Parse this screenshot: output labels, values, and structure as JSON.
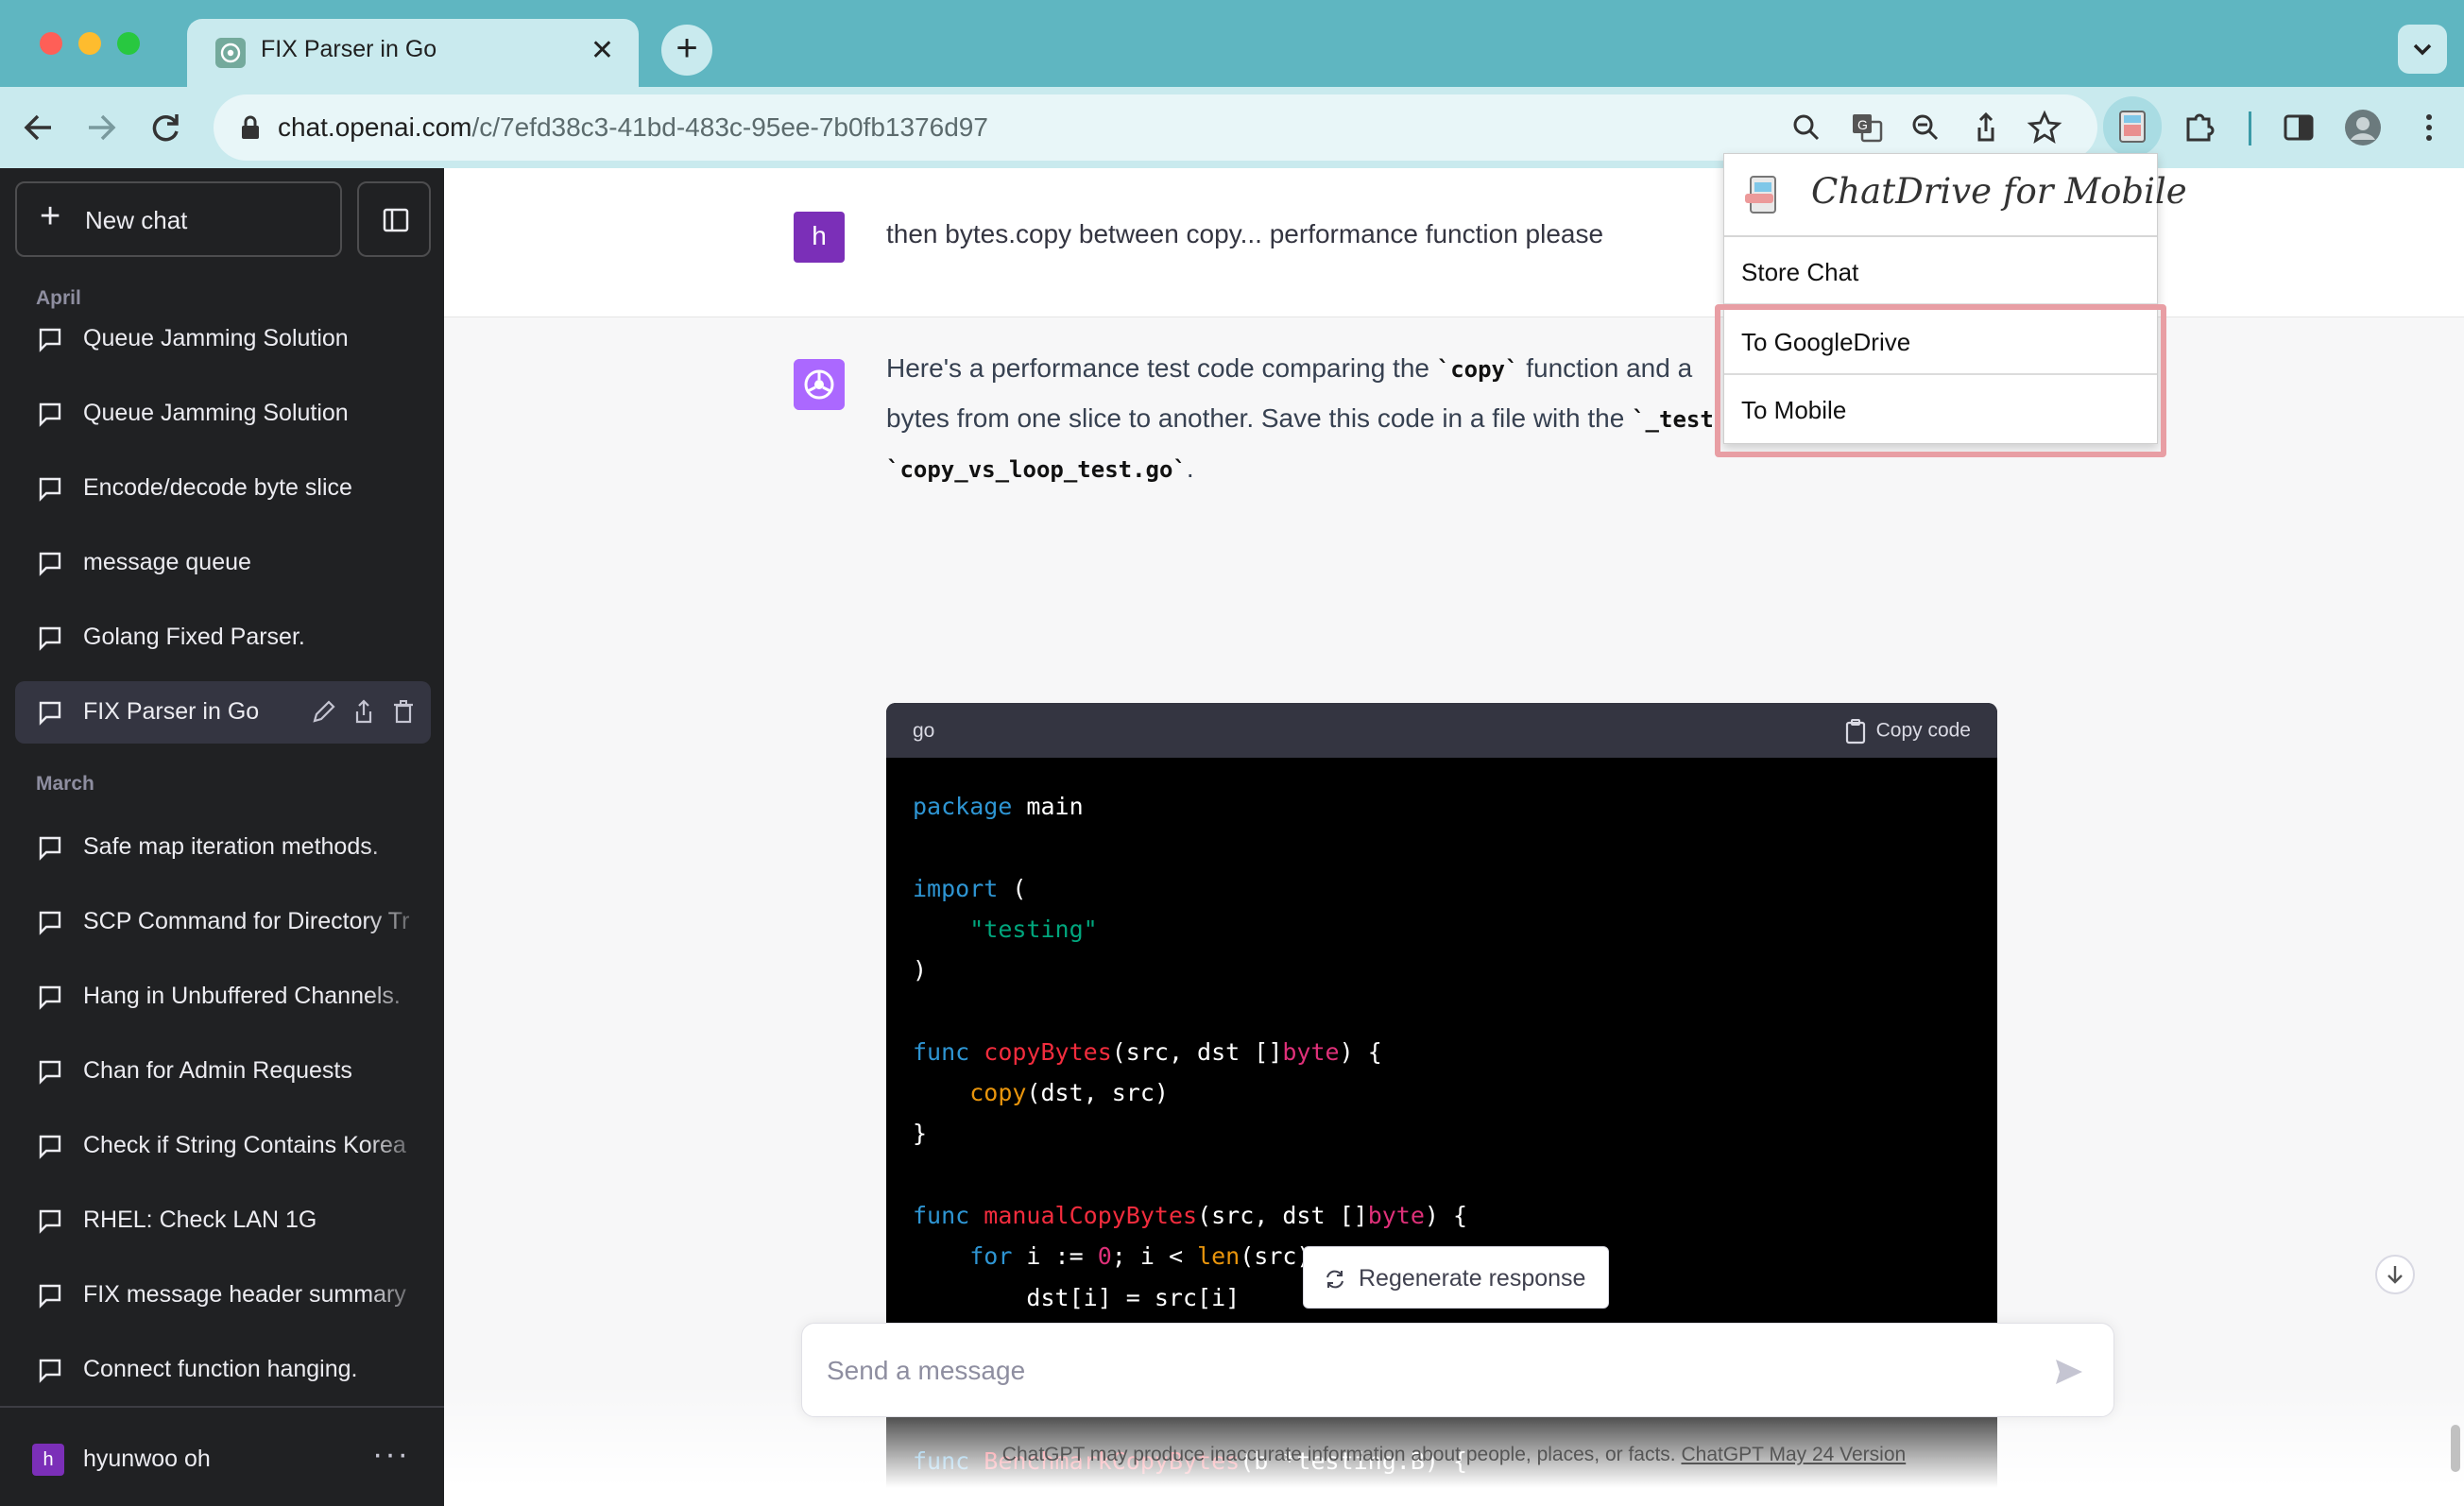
{
  "browser": {
    "tab_title": "FIX Parser in Go",
    "url_domain": "chat.openai.com",
    "url_path": "/c/7efd38c3-41bd-483c-95ee-7b0fb1376d97",
    "colors": {
      "frame": "#5fb6c1",
      "toolbar": "#c9eaee"
    },
    "toolbar_icons": [
      "back-arrow-icon",
      "forward-arrow-icon",
      "reload-icon",
      "lock-icon",
      "search-icon",
      "translate-icon",
      "zoom-out-icon",
      "share-icon",
      "star-icon",
      "chatdrive-extension-icon",
      "puzzle-icon",
      "side-panel-icon",
      "profile-avatar"
    ]
  },
  "sidebar": {
    "new_chat_label": "New chat",
    "sections": [
      {
        "label": "April",
        "items": [
          {
            "label": "Queue Jamming Solution"
          },
          {
            "label": "Queue Jamming Solution"
          },
          {
            "label": "Encode/decode byte slice"
          },
          {
            "label": "message queue"
          },
          {
            "label": "Golang Fixed Parser."
          },
          {
            "label": "FIX Parser in Go",
            "active": true
          }
        ]
      },
      {
        "label": "March",
        "items": [
          {
            "label": "Safe map iteration methods."
          },
          {
            "label": "SCP Command for Directory Tr"
          },
          {
            "label": "Hang in Unbuffered Channels."
          },
          {
            "label": "Chan for Admin Requests"
          },
          {
            "label": "Check if String Contains Korea"
          },
          {
            "label": "RHEL: Check LAN 1G"
          },
          {
            "label": "FIX message header summary"
          },
          {
            "label": "Connect function hanging."
          }
        ]
      }
    ],
    "user": {
      "initial": "h",
      "name": "hyunwoo oh",
      "more": "···"
    }
  },
  "conversation": {
    "user_initial": "h",
    "user_message": "then bytes.copy between copy... performance function please",
    "assistant": {
      "line1_pre": "Here's a performance test code comparing the ",
      "line1_code": "`copy`",
      "line1_post": " function and a",
      "line2_pre": "bytes from one slice to another. Save this code in a file with the ",
      "line2_code": "`_test",
      "line3_code": "`copy_vs_loop_test.go`",
      "line3_post": "."
    },
    "code_block": {
      "language": "go",
      "copy_label": "Copy code"
    }
  },
  "regenerate_label": "Regenerate response",
  "composer": {
    "placeholder": "Send a message"
  },
  "footer": {
    "note": "ChatGPT may produce inaccurate information about people, places, or facts. ",
    "link": "ChatGPT May 24 Version"
  },
  "popup": {
    "title": "ChatDrive for Mobile",
    "items": [
      "Store Chat",
      "To GoogleDrive",
      "To Mobile"
    ],
    "highlight_color": "#e89ea4"
  }
}
